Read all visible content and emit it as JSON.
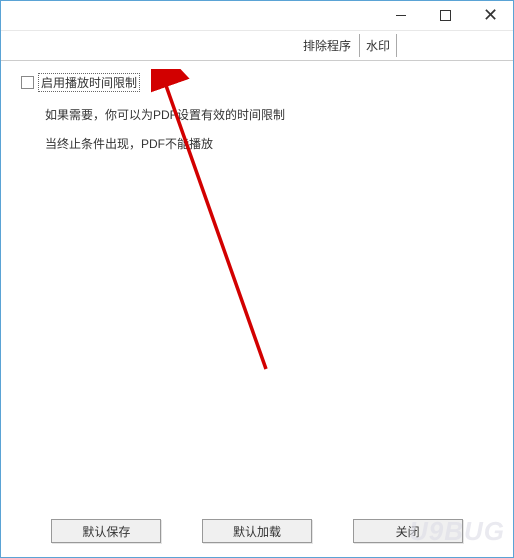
{
  "titlebar": {
    "close_glyph": "✕"
  },
  "tabs": {
    "t1": "排除程序",
    "t2": "水印"
  },
  "content": {
    "checkbox_label": "启用播放时间限制",
    "line1": "如果需要，你可以为PDF设置有效的时间限制",
    "line2": "当终止条件出现，PDF不能播放"
  },
  "buttons": {
    "default_save": "默认保存",
    "default_load": "默认加载",
    "close": "关闭"
  },
  "watermark": "U9BUG"
}
